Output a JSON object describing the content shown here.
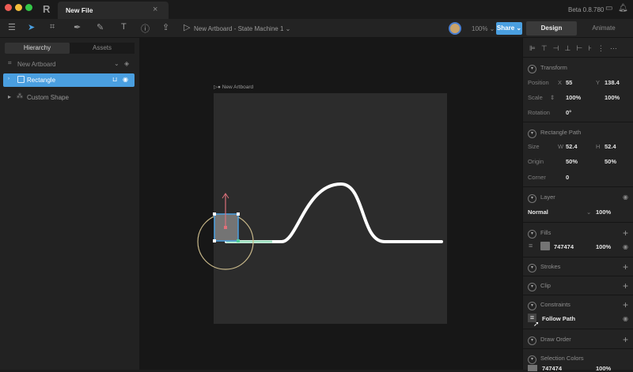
{
  "window": {
    "tab_title": "New File",
    "close": "×",
    "version": "Beta 0.8.780"
  },
  "toolbar": {
    "breadcrumb": "New Artboard - State Machine 1 ⌄",
    "zoom": "100% ⌄",
    "share": "Share ⌄",
    "design": "Design",
    "animate": "Animate"
  },
  "left": {
    "tabs": [
      "Hierarchy",
      "Assets"
    ],
    "artboard": "New Artboard",
    "items": [
      {
        "label": "Rectangle",
        "selected": true
      },
      {
        "label": "Custom Shape",
        "selected": false
      }
    ]
  },
  "canvas": {
    "artboard_label": "New Artboard"
  },
  "right": {
    "transform": {
      "title": "Transform",
      "position_label": "Position",
      "x_label": "X",
      "x": "55",
      "y_label": "Y",
      "y": "138.4",
      "scale_label": "Scale",
      "scale_x": "100%",
      "scale_y": "100%",
      "rotation_label": "Rotation",
      "rotation": "0°"
    },
    "rect_path": {
      "title": "Rectangle Path",
      "size_label": "Size",
      "w_label": "W",
      "w": "52.4",
      "h_label": "H",
      "h": "52.4",
      "origin_label": "Origin",
      "ox": "50%",
      "oy": "50%",
      "corner_label": "Corner",
      "corner": "0"
    },
    "layer": {
      "title": "Layer",
      "blend": "Normal",
      "opacity": "100%"
    },
    "fills": {
      "title": "Fills",
      "color": "747474",
      "opacity": "100%",
      "swatch": "#747474"
    },
    "strokes": "Strokes",
    "clip": "Clip",
    "constraints": {
      "title": "Constraints",
      "item": "Follow Path"
    },
    "draw_order": "Draw Order",
    "selection_colors": {
      "title": "Selection Colors",
      "color": "747474",
      "opacity": "100%"
    }
  },
  "colors": {
    "accent": "#4a9fe0"
  }
}
